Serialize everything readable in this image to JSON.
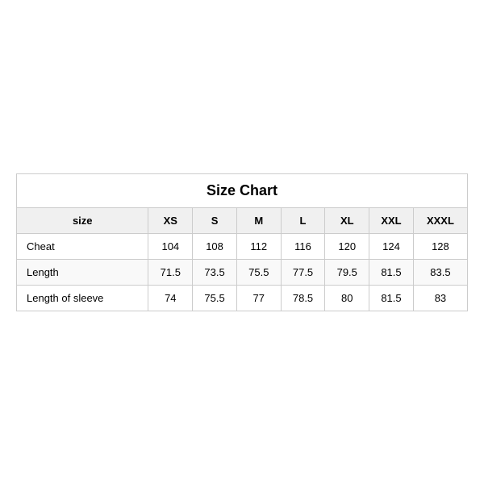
{
  "table": {
    "title": "Size Chart",
    "headers": [
      "size",
      "XS",
      "S",
      "M",
      "L",
      "XL",
      "XXL",
      "XXXL"
    ],
    "rows": [
      {
        "label": "Cheat",
        "values": [
          "104",
          "108",
          "112",
          "116",
          "120",
          "124",
          "128"
        ],
        "alt": false
      },
      {
        "label": "Length",
        "values": [
          "71.5",
          "73.5",
          "75.5",
          "77.5",
          "79.5",
          "81.5",
          "83.5"
        ],
        "alt": true
      },
      {
        "label": "Length of sleeve",
        "values": [
          "74",
          "75.5",
          "77",
          "78.5",
          "80",
          "81.5",
          "83"
        ],
        "alt": false
      }
    ]
  }
}
